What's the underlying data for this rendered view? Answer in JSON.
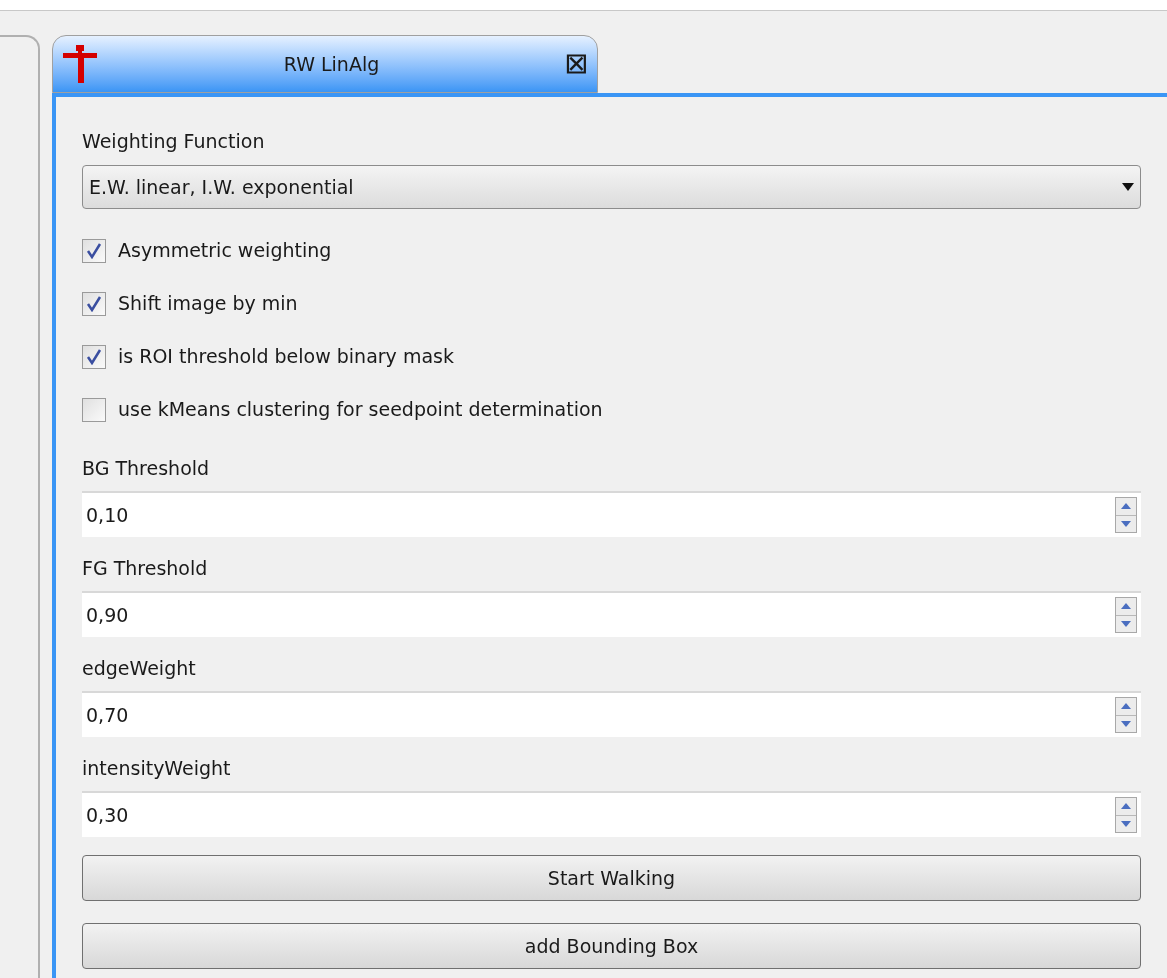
{
  "tab": {
    "title": "RW LinAlg",
    "close": "⮽"
  },
  "weighting": {
    "label": "Weighting Function",
    "value": "E.W. linear, I.W. exponential"
  },
  "checkboxes": [
    {
      "label": "Asymmetric weighting",
      "checked": true
    },
    {
      "label": "Shift image by min",
      "checked": true
    },
    {
      "label": "is ROI threshold below binary mask",
      "checked": true
    },
    {
      "label": "use kMeans clustering for seedpoint determination",
      "checked": false
    }
  ],
  "fields": [
    {
      "label": "BG Threshold",
      "value": "0,10"
    },
    {
      "label": "FG Threshold",
      "value": "0,90"
    },
    {
      "label": "edgeWeight",
      "value": "0,70"
    },
    {
      "label": "intensityWeight",
      "value": "0,30"
    }
  ],
  "buttons": [
    "Start Walking",
    "add Bounding Box"
  ]
}
